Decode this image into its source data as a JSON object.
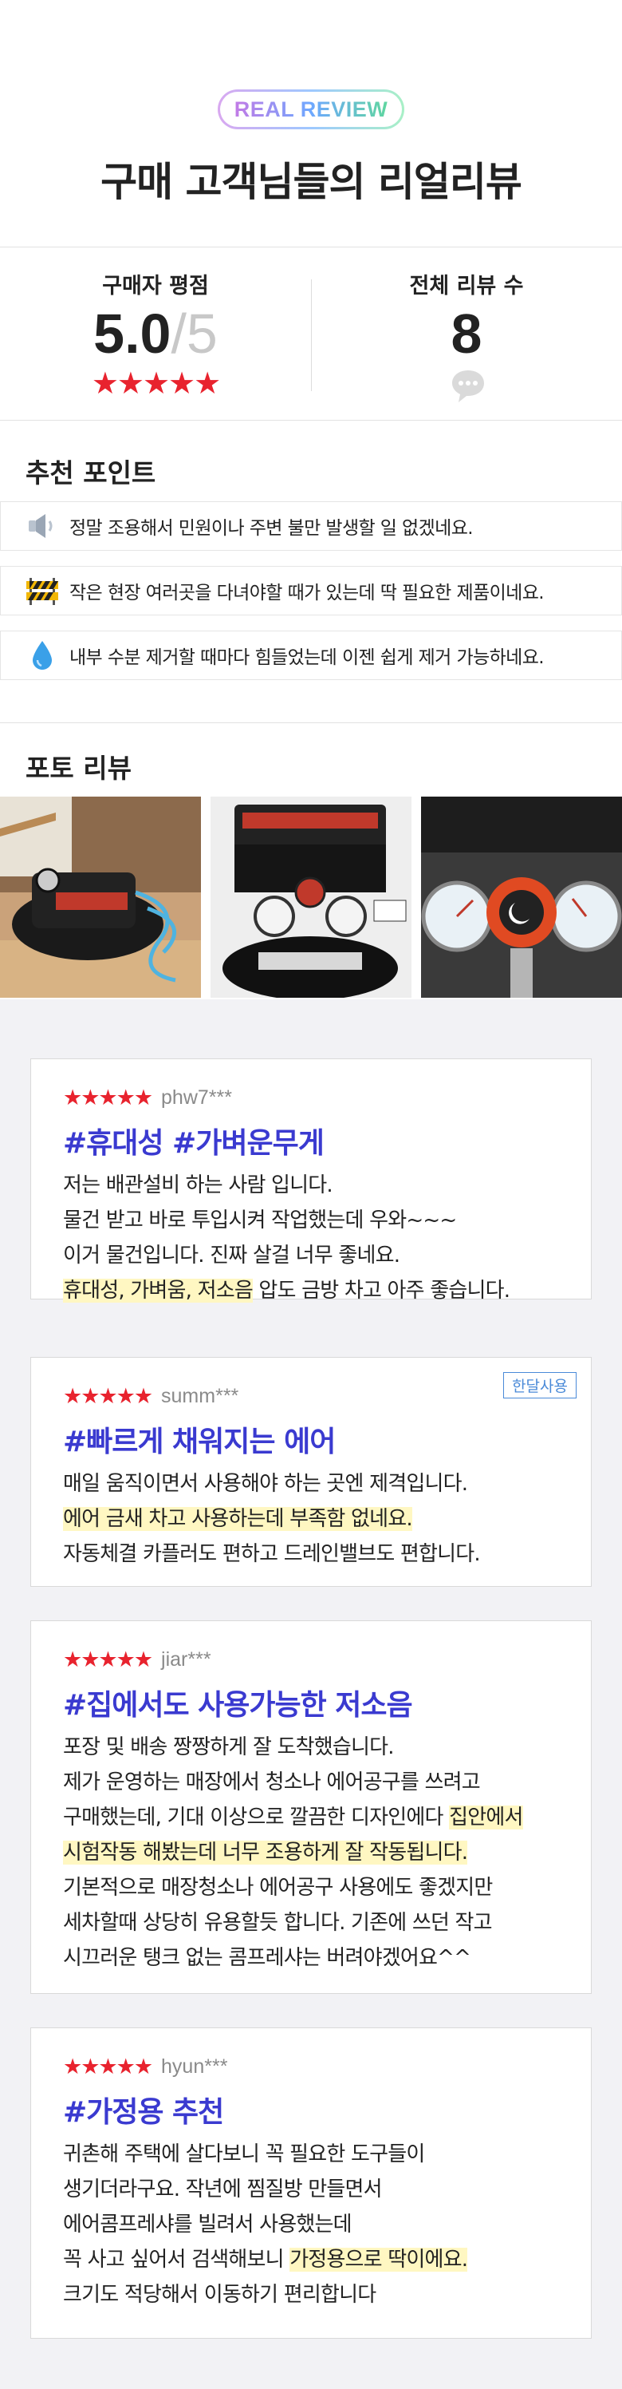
{
  "header": {
    "badge": "REAL REVIEW",
    "title": "구매 고객님들의 리얼리뷰"
  },
  "stats": {
    "rating_label": "구매자 평점",
    "rating_value": "5.0",
    "rating_max": "/5",
    "rating_stars": "★★★★★",
    "count_label": "전체 리뷰 수",
    "count_value": "8"
  },
  "recommend": {
    "title": "추천 포인트",
    "items": [
      {
        "icon": "speaker-icon",
        "text": "정말 조용해서 민원이나 주변 불만 발생할 일 없겠네요."
      },
      {
        "icon": "barrier-icon",
        "text": "작은 현장 여러곳을 다녀야할 때가 있는데 딱 필요한 제품이네요."
      },
      {
        "icon": "water-drop-icon",
        "text": "내부 수분 제거할 때마다 힘들었는데 이젠 쉽게 제거 가능하네요."
      }
    ]
  },
  "photo_review": {
    "title": "포토 리뷰",
    "photos": [
      "compressor-photo-1",
      "compressor-photo-2",
      "pressure-gauge-photo"
    ]
  },
  "reviews": [
    {
      "stars": "★★★★★",
      "user": "phw7***",
      "title": "#휴대성 #가벼운무게",
      "lines": [
        {
          "text": "저는 배관설비 하는 사람 입니다."
        },
        {
          "text": "물건 받고 바로 투입시켜 작업했는데 우와~~~"
        },
        {
          "text": "이거 물건입니다. 진짜 살걸 너무 좋네요."
        },
        {
          "hl": "휴대성, 가벼움, 저소음",
          "text": " 압도 금방 차고 아주 좋습니다."
        }
      ]
    },
    {
      "stars": "★★★★★",
      "user": "summ***",
      "tag": "한달사용",
      "title": "#빠르게 채워지는 에어",
      "lines": [
        {
          "text": "매일 움직이면서 사용해야 하는 곳엔 제격입니다."
        },
        {
          "hl": "에어 금새 차고 사용하는데 부족함 없네요.",
          "text": ""
        },
        {
          "text": "자동체결 카플러도 편하고 드레인밸브도 편합니다."
        }
      ]
    },
    {
      "stars": "★★★★★",
      "user": "jiar***",
      "title": "#집에서도 사용가능한 저소음",
      "lines": [
        {
          "text": "포장 및 배송 짱짱하게 잘 도착했습니다."
        },
        {
          "text": "제가 운영하는 매장에서 청소나 에어공구를 쓰려고"
        },
        {
          "text": "구매했는데, 기대 이상으로 깔끔한 디자인에다 ",
          "hl": "집안에서"
        },
        {
          "hl": "시험작동 해봤는데 너무 조용하게 잘 작동됩니다.",
          "text": ""
        },
        {
          "text": "기본적으로 매장청소나 에어공구 사용에도 좋겠지만"
        },
        {
          "text": "세차할때 상당히 유용할듯 합니다. 기존에 쓰던 작고"
        },
        {
          "text": "시끄러운 탱크 없는 콤프레샤는 버려야겠어요^^"
        }
      ]
    },
    {
      "stars": "★★★★★",
      "user": "hyun***",
      "title": "#가정용 추천",
      "lines": [
        {
          "text": "귀촌해 주택에 살다보니 꼭 필요한 도구들이"
        },
        {
          "text": "생기더라구요. 작년에 찜질방 만들면서"
        },
        {
          "text": "에어콤프레샤를 빌려서 사용했는데"
        },
        {
          "text": "꼭 사고 싶어서 검색해보니 ",
          "hl": "가정용으로 딱이에요."
        },
        {
          "text": "크기도 적당해서 이동하기 편리합니다"
        }
      ]
    }
  ]
}
